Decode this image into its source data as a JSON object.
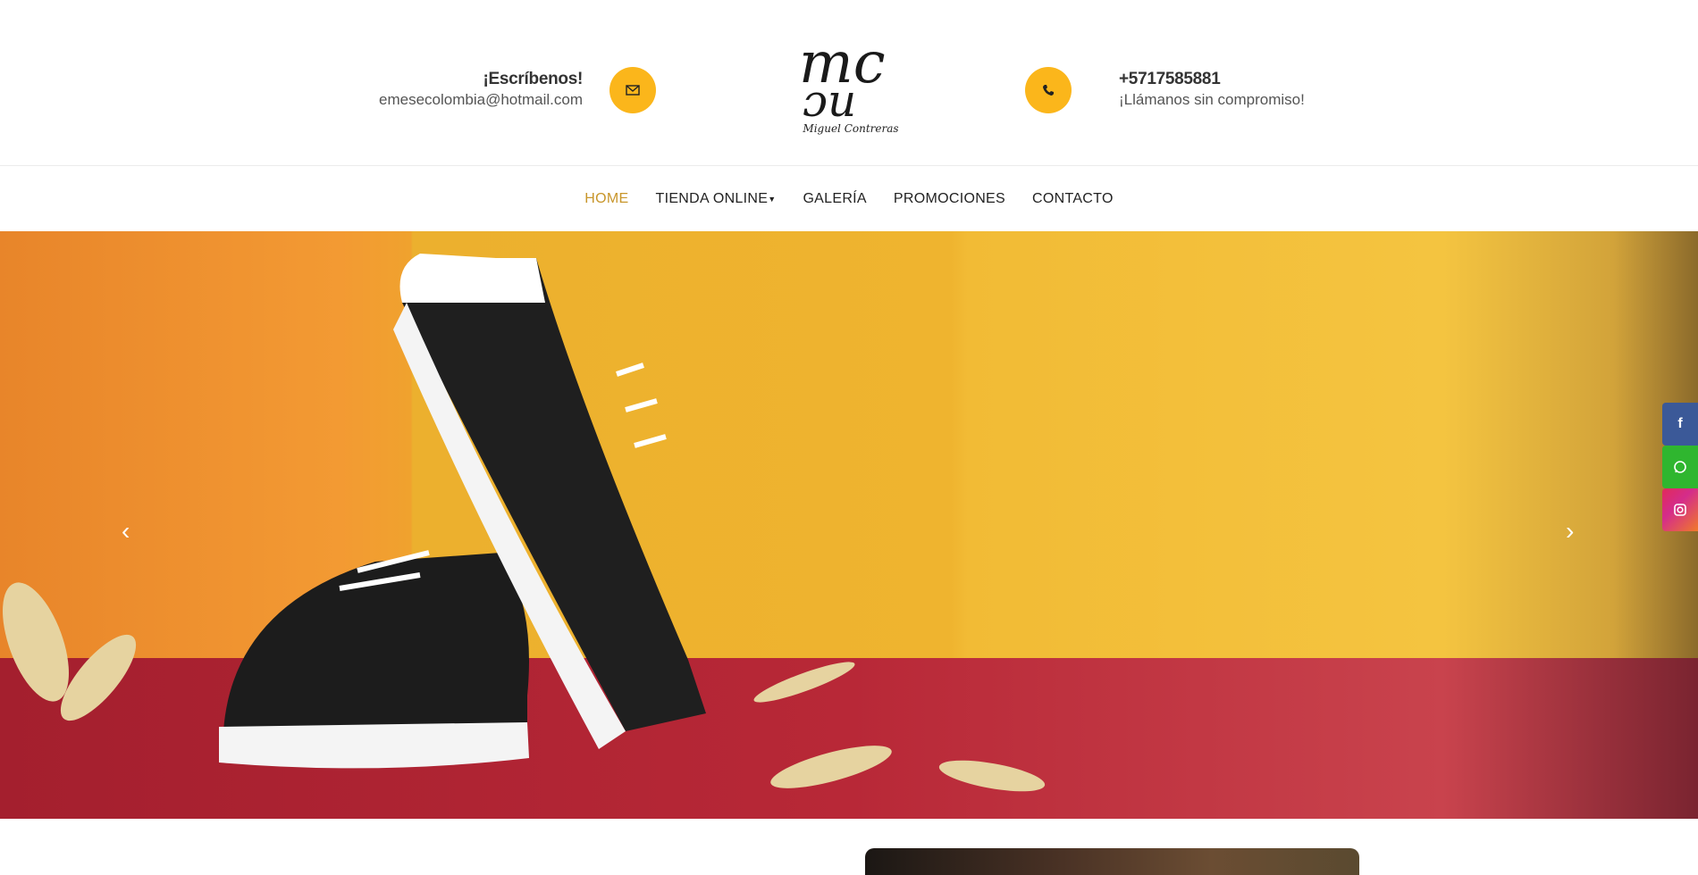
{
  "header": {
    "email": {
      "title": "¡Escríbenos!",
      "value": "emesecolombia@hotmail.com",
      "icon": "envelope-icon"
    },
    "phone": {
      "title": "+5717585881",
      "value": "¡Llámanos sin compromiso!",
      "icon": "phone-icon"
    },
    "logo": {
      "monogram": "mc ɔu",
      "name": "Miguel Contreras"
    }
  },
  "nav": {
    "items": [
      {
        "label": "HOME"
      },
      {
        "label": "TIENDA ONLINE"
      },
      {
        "label": "GALERÍA"
      },
      {
        "label": "PROMOCIONES"
      },
      {
        "label": "CONTACTO"
      }
    ]
  },
  "slider": {
    "prev": "‹",
    "next": "›"
  },
  "social": [
    {
      "name": "facebook",
      "glyph": "f",
      "color": "#3b5998"
    },
    {
      "name": "whatsapp",
      "color": "#2fb62f"
    },
    {
      "name": "instagram",
      "color": "#e1306c"
    }
  ],
  "colors": {
    "accent": "#fbb61b",
    "nav_active": "#c8962b"
  }
}
